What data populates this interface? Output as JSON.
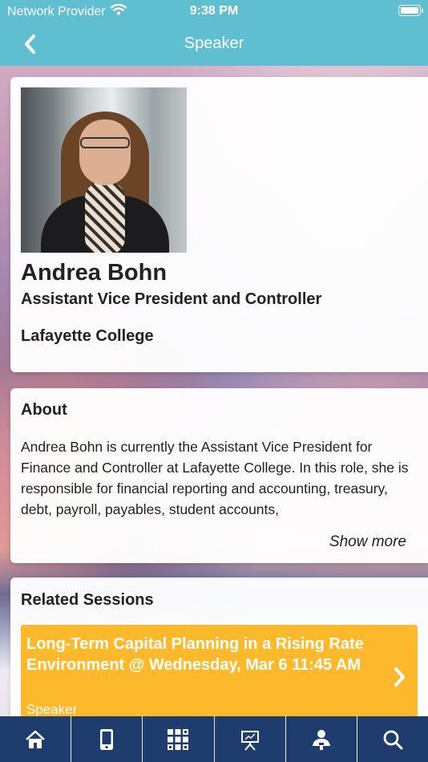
{
  "status_bar": {
    "carrier": "Network Provider",
    "time": "9:38 PM",
    "wifi_icon": "wifi-icon",
    "battery_icon": "battery-icon"
  },
  "nav": {
    "title": "Speaker",
    "back_icon": "chevron-left-icon"
  },
  "speaker": {
    "name": "Andrea Bohn",
    "title": "Assistant Vice President and Controller",
    "organization": "Lafayette College"
  },
  "about": {
    "heading": "About",
    "text": "Andrea Bohn is currently the Assistant Vice President for Finance and Controller at Lafayette College. In this role, she is responsible for financial reporting and accounting, treasury, debt, payroll, payables, student accounts,",
    "show_more_label": "Show more"
  },
  "related_sessions": {
    "heading": "Related Sessions",
    "items": [
      {
        "title": "Long-Term Capital Planning in a Rising Rate Environment @ Wednesday, Mar 6 11:45 AM",
        "role": "Speaker"
      }
    ]
  },
  "tabbar": {
    "tabs": [
      {
        "icon": "home-icon"
      },
      {
        "icon": "mobile-device-icon"
      },
      {
        "icon": "grid-qr-icon"
      },
      {
        "icon": "presentation-board-icon"
      },
      {
        "icon": "speaker-person-icon"
      },
      {
        "icon": "search-icon"
      }
    ]
  },
  "colors": {
    "header": "#5fbfd1",
    "session_card": "#fcb92c",
    "tabbar": "#1f3c6f"
  }
}
